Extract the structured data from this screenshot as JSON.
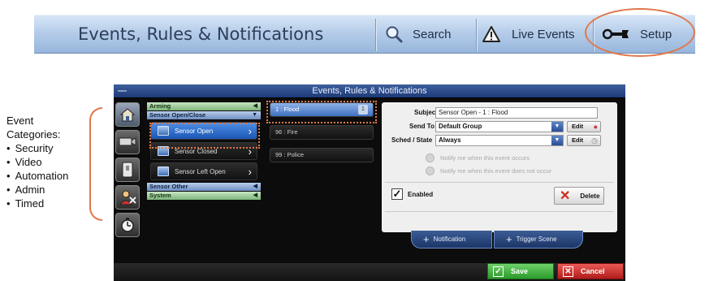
{
  "topbar": {
    "title": "Events, Rules & Notifications",
    "search_label": "Search",
    "live_events_label": "Live Events",
    "setup_label": "Setup"
  },
  "legend": {
    "heading_line1": "Event",
    "heading_line2": "Categories:",
    "items": [
      "Security",
      "Video",
      "Automation",
      "Admin",
      "Timed"
    ]
  },
  "window": {
    "title": "Events, Rules & Notifications",
    "minimize": "—",
    "categories": [
      "security-icon",
      "video-camera-icon",
      "automation-icon",
      "admin-icon",
      "timer-icon"
    ],
    "groups": {
      "arming": "Arming",
      "sensor_open_close": "Sensor Open/Close",
      "sensor_other": "Sensor Other",
      "system": "System"
    },
    "sensor_items": [
      "Sensor Open",
      "Sensor Closed",
      "Sensor Left Open"
    ],
    "events": [
      {
        "label": "1 : Flood",
        "count": "1"
      },
      {
        "label": "96 : Fire",
        "count": ""
      },
      {
        "label": "99 : Police",
        "count": ""
      }
    ],
    "detail": {
      "subject_label": "Subject",
      "subject_value": "Sensor Open - 1 : Flood",
      "send_to_label": "Send To",
      "send_to_value": "Default Group",
      "sched_label": "Sched / State",
      "sched_value": "Always",
      "edit_label": "Edit",
      "radio1": "Notify me when this event occurs",
      "radio2": "Notify me when this event does not occur",
      "enabled_label": "Enabled",
      "delete_label": "Delete"
    },
    "tabs": {
      "notification": "Notification",
      "trigger_scene": "Trigger Scene"
    },
    "footer": {
      "save": "Save",
      "cancel": "Cancel"
    }
  },
  "colors": {
    "highlight": "#e0784a",
    "selected_blue": "#1b56b4",
    "save_green": "#2b9a2a",
    "cancel_red": "#b11c1a"
  }
}
